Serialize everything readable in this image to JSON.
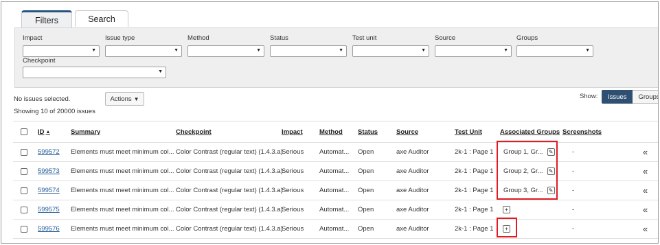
{
  "tabs": [
    {
      "label": "Filters",
      "active": true
    },
    {
      "label": "Search",
      "active": false
    }
  ],
  "filters": {
    "impact": "Impact",
    "issue_type": "Issue type",
    "method": "Method",
    "status": "Status",
    "test_unit": "Test unit",
    "source": "Source",
    "groups": "Groups",
    "checkpoint": "Checkpoint"
  },
  "toolbar": {
    "selection": "No issues selected.",
    "showing": "Showing 10 of 20000 issues",
    "actions_label": "Actions",
    "show_label": "Show:",
    "view_issues": "Issues",
    "view_groups": "Groups"
  },
  "table": {
    "headers": {
      "id": "ID",
      "summary": "Summary",
      "checkpoint": "Checkpoint",
      "impact": "Impact",
      "method": "Method",
      "status": "Status",
      "source": "Source",
      "test_unit": "Test Unit",
      "groups": "Associated Groups",
      "screenshots": "Screenshots"
    },
    "rows": [
      {
        "id": "599572",
        "summary": "Elements must meet minimum col...",
        "checkpoint": "Color Contrast (regular text) (1.4.3.a)",
        "impact": "Serious",
        "method": "Automat...",
        "status": "Open",
        "source": "axe Auditor",
        "test_unit": "2k-1 : Page 1",
        "groups": "Group 1, Gr...",
        "screenshots": "-"
      },
      {
        "id": "599573",
        "summary": "Elements must meet minimum col...",
        "checkpoint": "Color Contrast (regular text) (1.4.3.a)",
        "impact": "Serious",
        "method": "Automat...",
        "status": "Open",
        "source": "axe Auditor",
        "test_unit": "2k-1 : Page 1",
        "groups": "Group 2, Gr...",
        "screenshots": "-"
      },
      {
        "id": "599574",
        "summary": "Elements must meet minimum col...",
        "checkpoint": "Color Contrast (regular text) (1.4.3.a)",
        "impact": "Serious",
        "method": "Automat...",
        "status": "Open",
        "source": "axe Auditor",
        "test_unit": "2k-1 : Page 1",
        "groups": "Group 3, Gr...",
        "screenshots": "-"
      },
      {
        "id": "599575",
        "summary": "Elements must meet minimum col...",
        "checkpoint": "Color Contrast (regular text) (1.4.3.a)",
        "impact": "Serious",
        "method": "Automat...",
        "status": "Open",
        "source": "axe Auditor",
        "test_unit": "2k-1 : Page 1",
        "groups": "",
        "screenshots": "-"
      },
      {
        "id": "599576",
        "summary": "Elements must meet minimum col...",
        "checkpoint": "Color Contrast (regular text) (1.4.3.a)",
        "impact": "Serious",
        "method": "Automat...",
        "status": "Open",
        "source": "axe Auditor",
        "test_unit": "2k-1 : Page 1",
        "groups": "",
        "screenshots": "-"
      }
    ]
  },
  "icons": {
    "sort": "sort-ascending-icon",
    "edit": "pencil-icon",
    "add": "plus-icon",
    "expand": "double-chevron-left-icon",
    "dropdown": "caret-down-icon"
  },
  "colors": {
    "tab_accent": "#24547f",
    "toggle_active": "#2f4f73",
    "link": "#1f5a96",
    "highlight": "#e01b24"
  }
}
